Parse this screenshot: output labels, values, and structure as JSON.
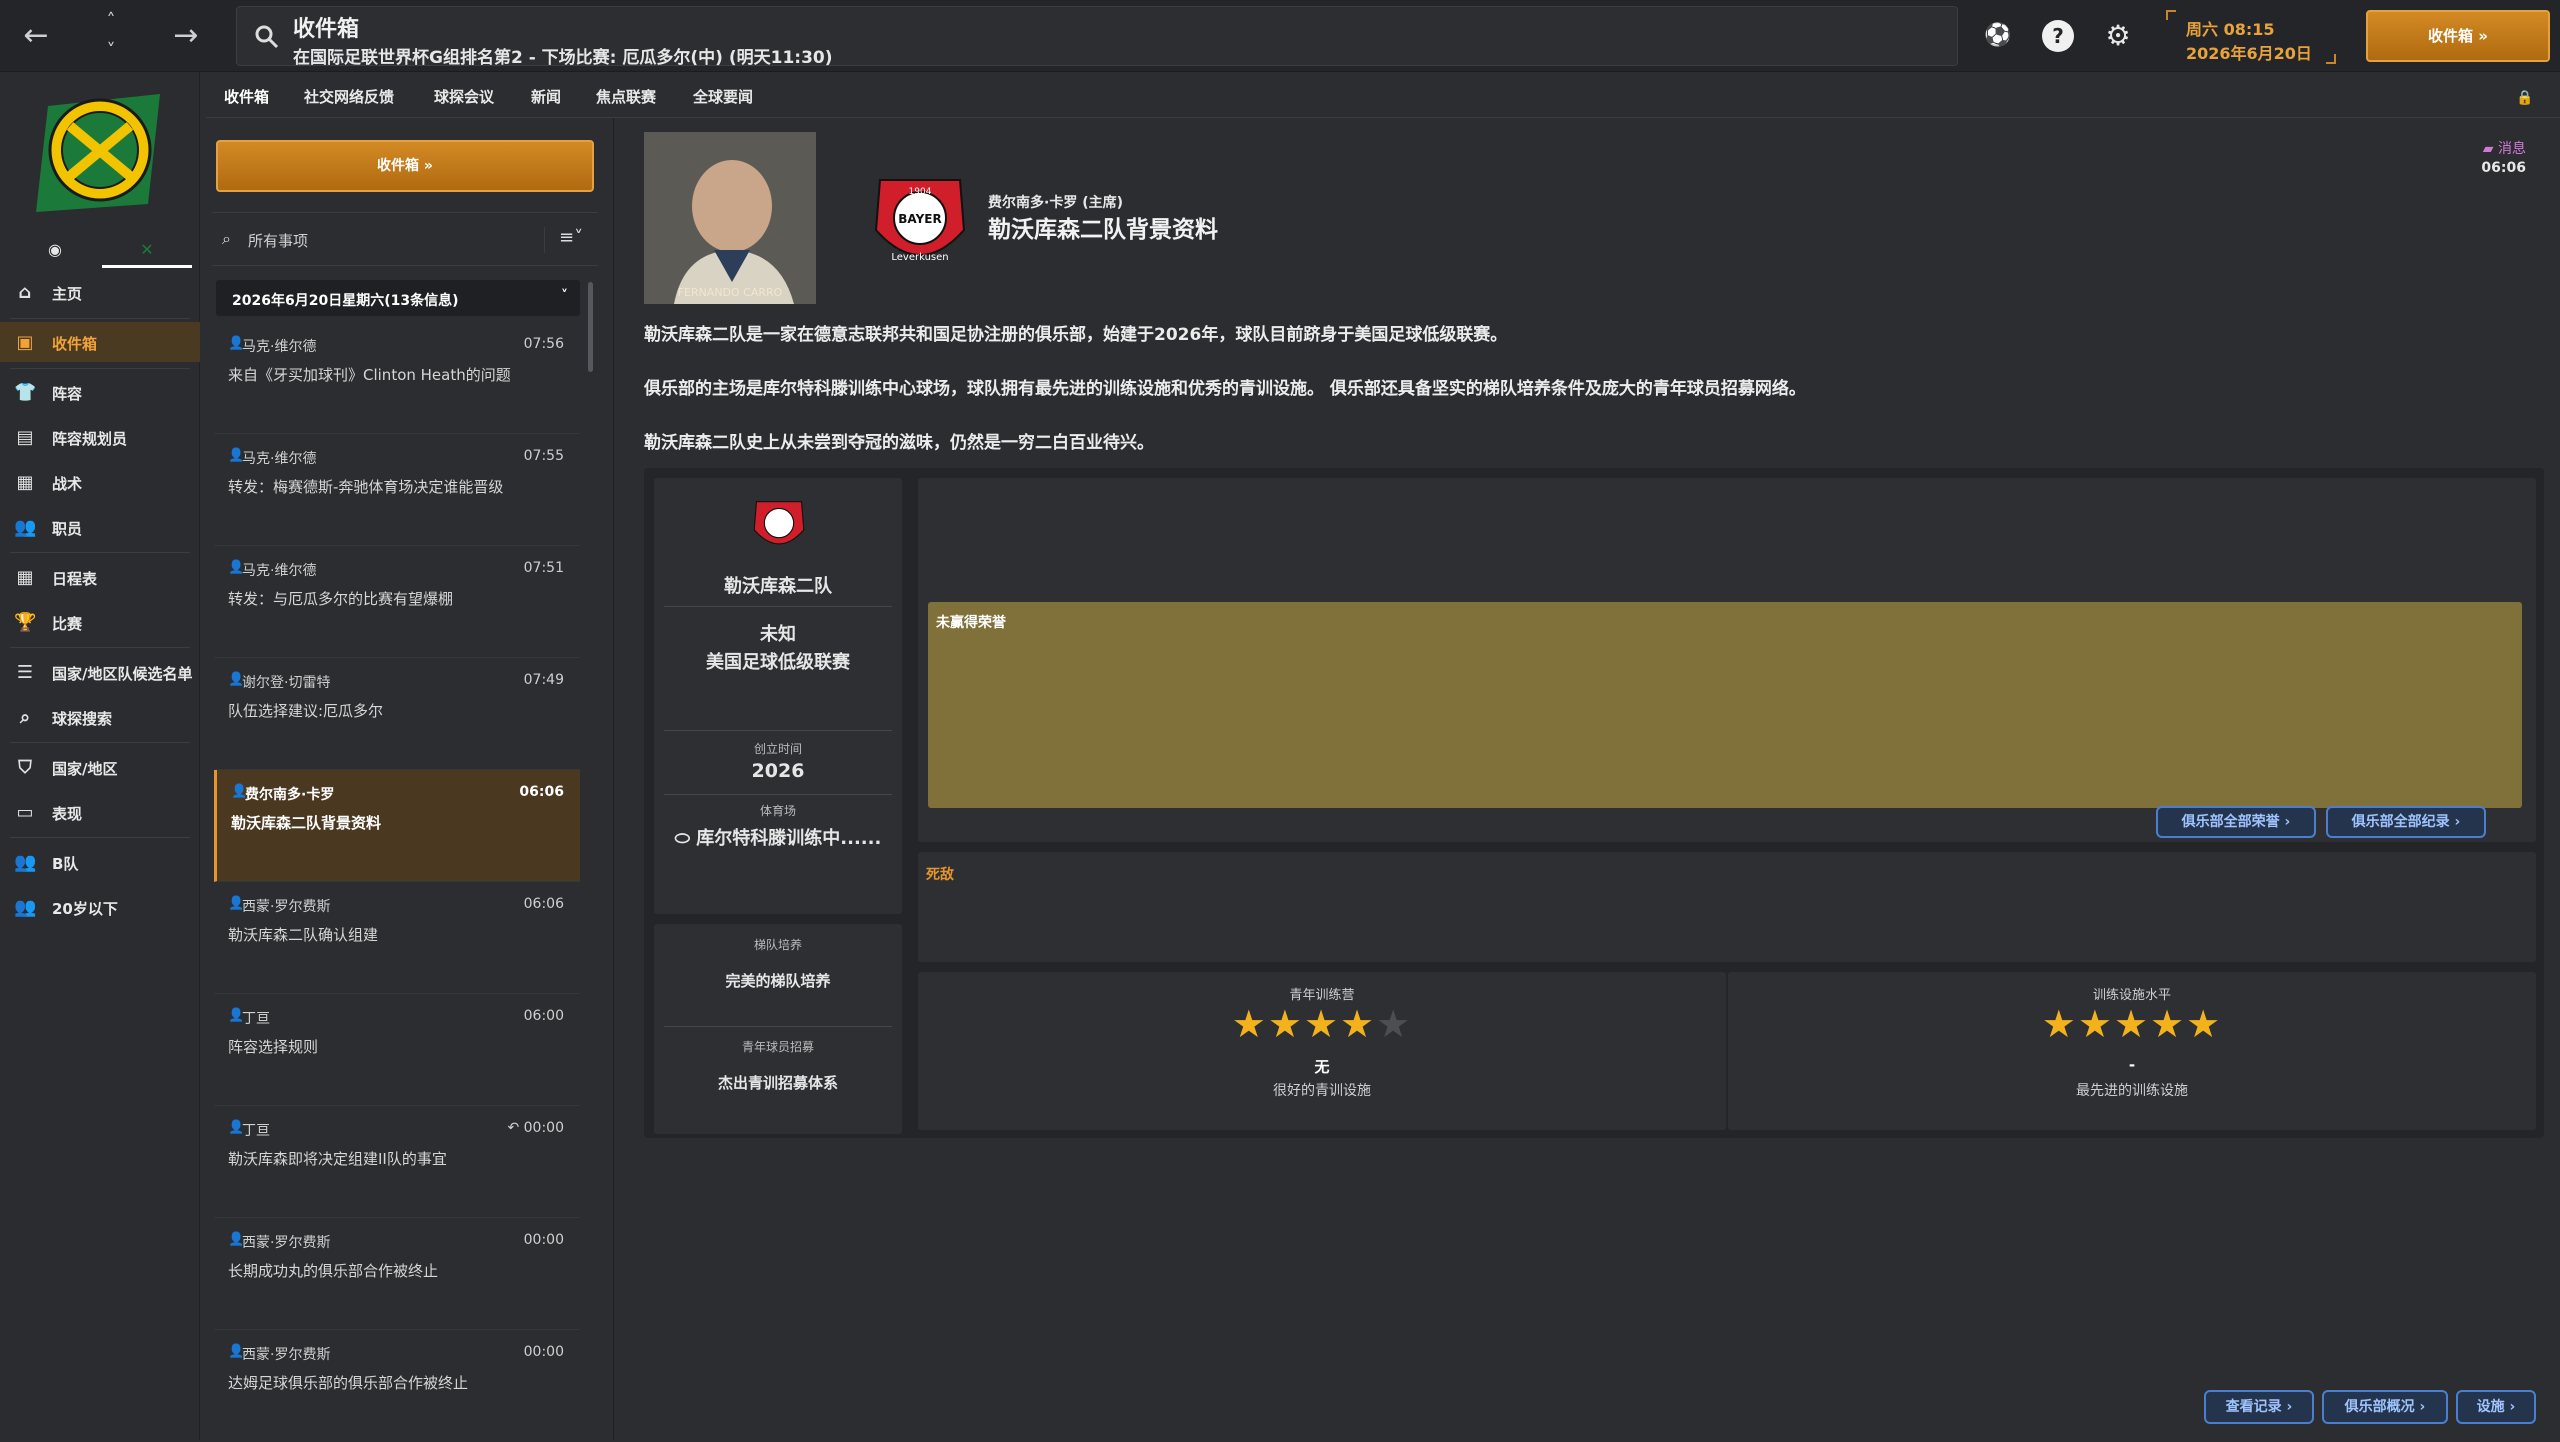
{
  "header": {
    "title": "收件箱",
    "subtitle": "在国际足联世界杯G组排名第2 - 下场比赛: 厄瓜多尔(中) (明天11:30)",
    "date_line1": "周六 08:15",
    "date_line2": "2026年6月20日",
    "inbox_button": "收件箱 »"
  },
  "sidebar": {
    "items": [
      {
        "label": "主页",
        "icon": "home-icon"
      },
      {
        "label": "收件箱",
        "icon": "inbox-icon"
      },
      {
        "label": "阵容",
        "icon": "shirt-icon"
      },
      {
        "label": "阵容规划员",
        "icon": "clipboard-icon"
      },
      {
        "label": "战术",
        "icon": "tactics-icon"
      },
      {
        "label": "职员",
        "icon": "staff-icon"
      },
      {
        "label": "日程表",
        "icon": "calendar-icon"
      },
      {
        "label": "比赛",
        "icon": "trophy-icon"
      },
      {
        "label": "国家/地区队候选名单",
        "icon": "list-icon"
      },
      {
        "label": "球探搜索",
        "icon": "search-icon"
      },
      {
        "label": "国家/地区",
        "icon": "shield-icon"
      },
      {
        "label": "表现",
        "icon": "briefcase-icon"
      },
      {
        "label": "B队",
        "icon": "team-icon"
      },
      {
        "label": "20岁以下",
        "icon": "youth-icon"
      }
    ]
  },
  "tabs": [
    "收件箱",
    "社交网络反馈",
    "球探会议",
    "新闻",
    "焦点联赛",
    "全球要闻"
  ],
  "inbox": {
    "button": "收件箱 »",
    "filter_placeholder": "所有事项",
    "day_header": "2026年6月20日星期六(13条信息)",
    "messages": [
      {
        "from": "马克·维尔德",
        "time": "07:56",
        "subject": "来自《牙买加球刊》Clinton Heath的问题"
      },
      {
        "from": "马克·维尔德",
        "time": "07:55",
        "subject": "转发：梅赛德斯-奔驰体育场决定谁能晋级"
      },
      {
        "from": "马克·维尔德",
        "time": "07:51",
        "subject": "转发：与厄瓜多尔的比赛有望爆棚"
      },
      {
        "from": "谢尔登·切雷特",
        "time": "07:49",
        "subject": "队伍选择建议:厄瓜多尔"
      },
      {
        "from": "费尔南多·卡罗",
        "time": "06:06",
        "subject": "勒沃库森二队背景资料"
      },
      {
        "from": "西蒙·罗尔费斯",
        "time": "06:06",
        "subject": "勒沃库森二队确认组建"
      },
      {
        "from": "丁亘",
        "time": "06:00",
        "subject": "阵容选择规则"
      },
      {
        "from": "丁亘",
        "time": "↶ 00:00",
        "subject": "勒沃库森即将决定组建II队的事宜"
      },
      {
        "from": "西蒙·罗尔费斯",
        "time": "00:00",
        "subject": "长期成功丸的俱乐部合作被终止"
      },
      {
        "from": "西蒙·罗尔费斯",
        "time": "00:00",
        "subject": "达姆足球俱乐部的俱乐部合作被终止"
      }
    ]
  },
  "message": {
    "from": "费尔南多·卡罗 (主席)",
    "subject": "勒沃库森二队背景资料",
    "tag": "消息",
    "time": "06:06",
    "portrait_caption": "FERNANDO CARRO",
    "crest_text": "BAYER",
    "crest_year": "1904",
    "crest_bottom": "Leverkusen",
    "paragraphs": [
      "勒沃库森二队是一家在德意志联邦共和国足协注册的俱乐部，始建于2026年，球队目前跻身于美国足球低级联赛。",
      "俱乐部的主场是库尔特科滕训练中心球场，球队拥有最先进的训练设施和优秀的青训设施。 俱乐部还具备坚实的梯队培养条件及庞大的青年球员招募网络。",
      "勒沃库森二队史上从未尝到夺冠的滋味，仍然是一穷二白百业待兴。"
    ]
  },
  "club": {
    "name": "勒沃库森二队",
    "status": "未知",
    "league": "美国足球低级联赛",
    "founded_label": "创立时间",
    "founded": "2026",
    "stadium_label": "体育场",
    "stadium": "库尔特科滕训练中......",
    "youth_label": "梯队培养",
    "youth_value": "完美的梯队培养",
    "recruit_label": "青年球员招募",
    "recruit_value": "杰出青训招募体系"
  },
  "honors": {
    "none_text": "未赢得荣誉",
    "btn_honors": "俱乐部全部荣誉 ›",
    "btn_records": "俱乐部全部纪录 ›"
  },
  "rivals": {
    "label": "死敌"
  },
  "facilities": [
    {
      "label": "青年训练营",
      "stars": 4,
      "max": 5,
      "value": "无",
      "desc": "很好的青训设施"
    },
    {
      "label": "训练设施水平",
      "stars": 5,
      "max": 5,
      "value": "-",
      "desc": "最先进的训练设施"
    }
  ],
  "footer": {
    "btn1": "查看记录 ›",
    "btn2": "俱乐部概况 ›",
    "btn3": "设施 ›"
  },
  "colors": {
    "accent": "#e6952c",
    "honors_bg": "#80703a",
    "link": "#4a7fcf"
  }
}
